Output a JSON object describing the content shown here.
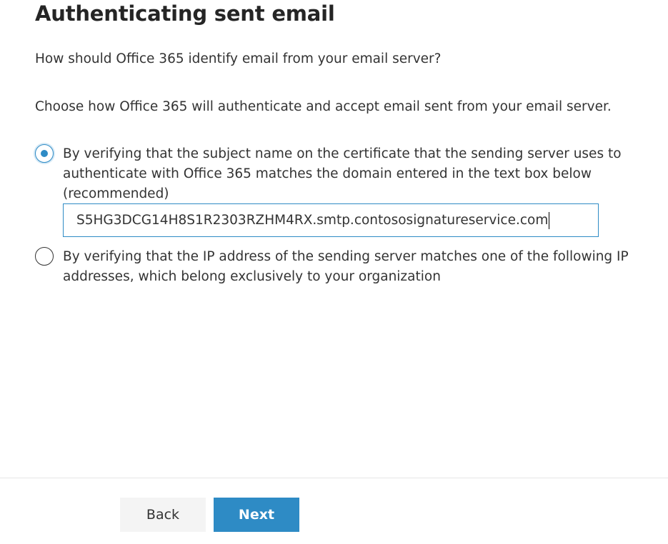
{
  "page": {
    "title": "Authenticating sent email",
    "question": "How should Office 365 identify email from your email server?",
    "instruction": "Choose how Office 365 will authenticate and accept email sent from your email server."
  },
  "options": [
    {
      "selected": true,
      "label_lines": [
        "By verifying that the subject name on the certificate that the sending server uses to",
        "authenticate with Office 365 matches the domain entered in the text box below",
        "(recommended)"
      ]
    },
    {
      "selected": false,
      "label_lines": [
        "By verifying that the IP address of the sending server matches one of the following IP",
        "addresses, which belong exclusively to your organization"
      ]
    }
  ],
  "domain_input": {
    "value": "S5HG3DCG14H8S1R2303RZHM4RX.smtp.contososignatureservice.com"
  },
  "footer": {
    "back_label": "Back",
    "next_label": "Next"
  },
  "colors": {
    "accent": "#2e8bc5",
    "text": "#333333",
    "back_button_bg": "#f4f4f4"
  }
}
